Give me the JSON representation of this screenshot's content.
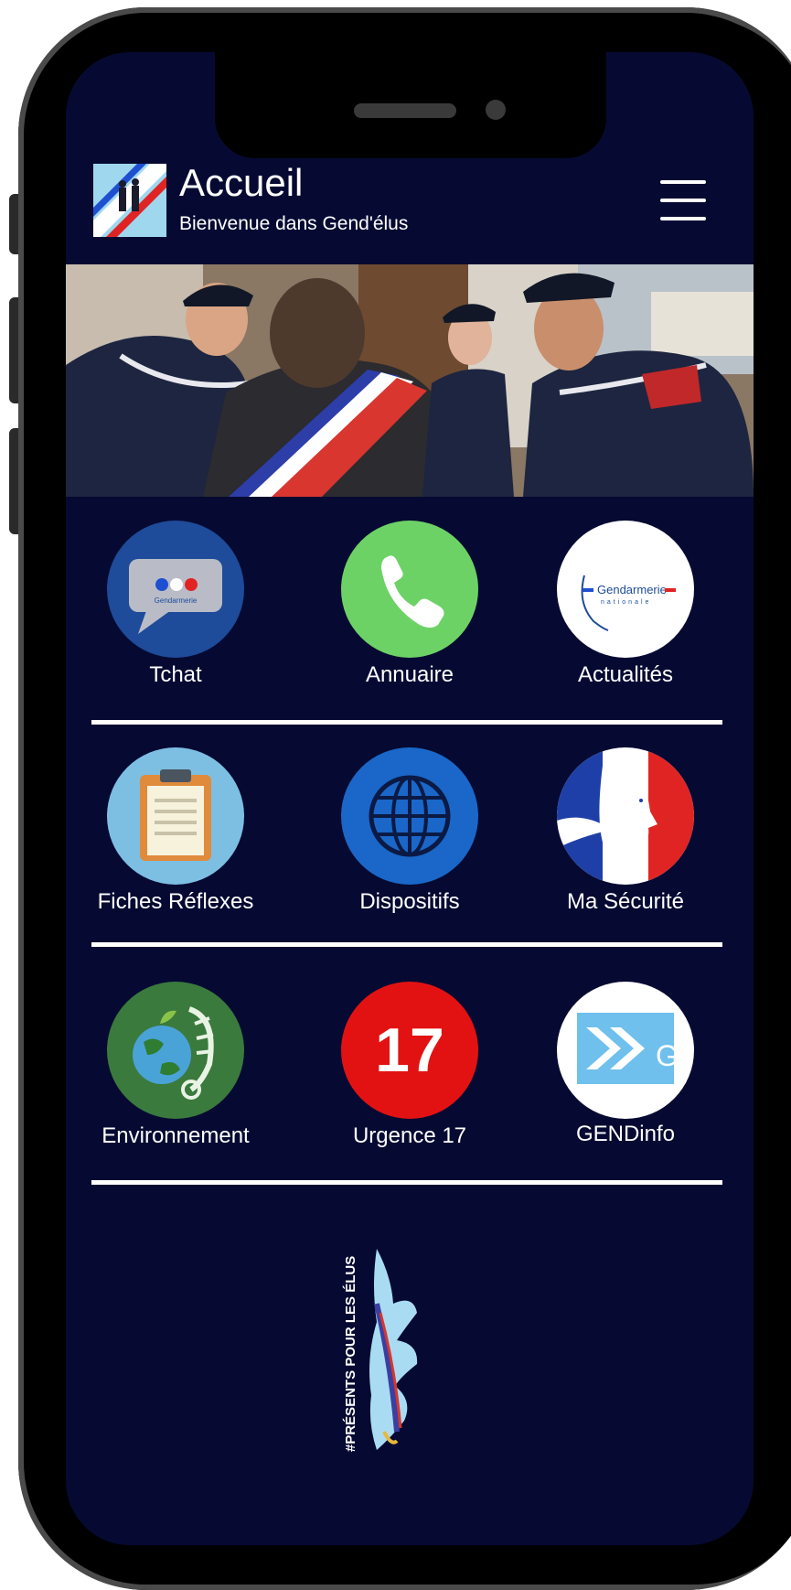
{
  "header": {
    "title": "Accueil",
    "subtitle": "Bienvenue dans Gend'élus"
  },
  "menu": {
    "icon": "hamburger-menu-icon"
  },
  "tiles": [
    {
      "label": "Tchat",
      "icon": "chat-bubble-icon",
      "color": "#1e4b9a"
    },
    {
      "label": "Annuaire",
      "icon": "phone-icon",
      "color": "#6dd266"
    },
    {
      "label": "Actualités",
      "icon": "gendarmerie-nationale-icon",
      "color": "#ffffff"
    },
    {
      "label": "Fiches Réflexes",
      "icon": "clipboard-icon",
      "color": "#7dbfe2"
    },
    {
      "label": "Dispositifs",
      "icon": "globe-icon",
      "color": "#1a67c9"
    },
    {
      "label": "Ma Sécurité",
      "icon": "marianne-icon",
      "color": "#ffffff"
    },
    {
      "label": "Environnement",
      "icon": "earth-leaf-icon",
      "color": "#3a7a3d"
    },
    {
      "label": "Urgence 17",
      "icon": "emergency-17-icon",
      "color": "#e31212"
    },
    {
      "label": "GENDinfo",
      "icon": "gendinfo-icon",
      "color": "#ffffff"
    }
  ],
  "urgence_number": "17",
  "gendarmerie_word": "Gendarmerie",
  "gendarmerie_sub": "nationale",
  "chat_logo_text": "Gendarmerie",
  "gendinfo_letter": "G",
  "footer": {
    "slogan": "#PRÉSENTS POUR LES ÉLUS"
  },
  "colors": {
    "background": "#060a32",
    "accent_blue": "#1e4b9a",
    "accent_red": "#e31212",
    "text": "#ffffff"
  }
}
